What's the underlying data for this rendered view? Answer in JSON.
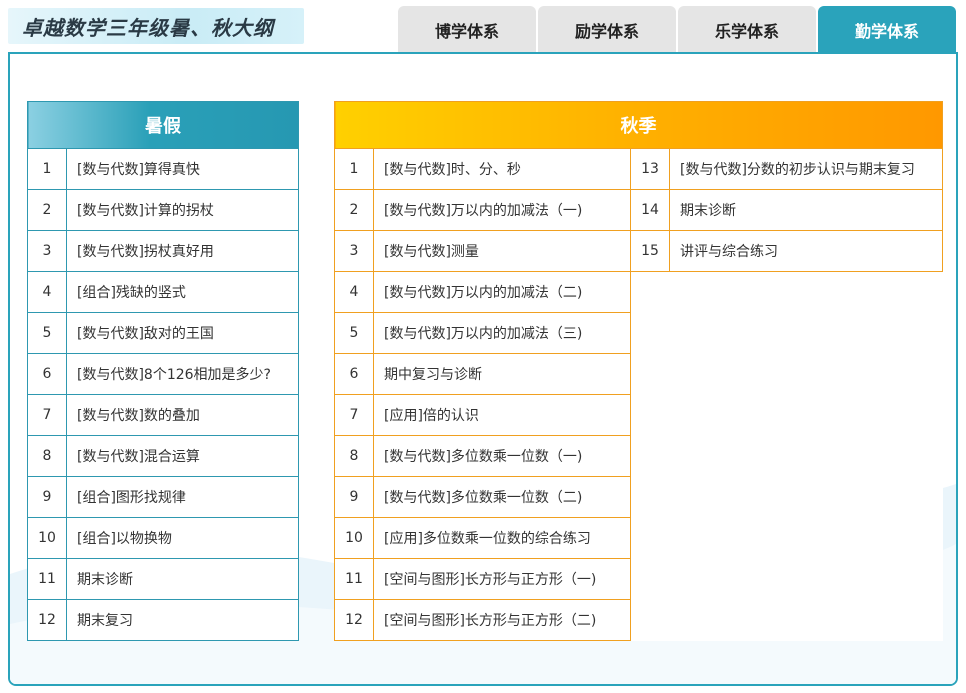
{
  "header": {
    "title": "卓越数学三年级暑、秋大纲",
    "tabs": [
      {
        "label": "博学体系",
        "active": false
      },
      {
        "label": "励学体系",
        "active": false
      },
      {
        "label": "乐学体系",
        "active": false
      },
      {
        "label": "勤学体系",
        "active": true
      }
    ]
  },
  "colors": {
    "accent": "#2aa3bb",
    "summer_border": "#2e98b0",
    "autumn_border": "#f0a020",
    "autumn_header_start": "#ffd000",
    "autumn_header_end": "#ff9800"
  },
  "summer": {
    "title": "暑假",
    "rows": [
      {
        "num": "1",
        "text": "[数与代数]算得真快"
      },
      {
        "num": "2",
        "text": "[数与代数]计算的拐杖"
      },
      {
        "num": "3",
        "text": "[数与代数]拐杖真好用"
      },
      {
        "num": "4",
        "text": "[组合]残缺的竖式"
      },
      {
        "num": "5",
        "text": "[数与代数]敌对的王国"
      },
      {
        "num": "6",
        "text": "[数与代数]8个126相加是多少?"
      },
      {
        "num": "7",
        "text": "[数与代数]数的叠加"
      },
      {
        "num": "8",
        "text": "[数与代数]混合运算"
      },
      {
        "num": "9",
        "text": "[组合]图形找规律"
      },
      {
        "num": "10",
        "text": "[组合]以物换物"
      },
      {
        "num": "11",
        "text": "期末诊断"
      },
      {
        "num": "12",
        "text": "期末复习"
      }
    ]
  },
  "autumn": {
    "title": "秋季",
    "left_rows": [
      {
        "num": "1",
        "text": "[数与代数]时、分、秒"
      },
      {
        "num": "2",
        "text": "[数与代数]万以内的加减法（一)"
      },
      {
        "num": "3",
        "text": "[数与代数]测量"
      },
      {
        "num": "4",
        "text": "[数与代数]万以内的加减法（二)"
      },
      {
        "num": "5",
        "text": "[数与代数]万以内的加减法（三)"
      },
      {
        "num": "6",
        "text": "期中复习与诊断"
      },
      {
        "num": "7",
        "text": "[应用]倍的认识"
      },
      {
        "num": "8",
        "text": "[数与代数]多位数乘一位数（一)"
      },
      {
        "num": "9",
        "text": "[数与代数]多位数乘一位数（二)"
      },
      {
        "num": "10",
        "text": "[应用]多位数乘一位数的综合练习"
      },
      {
        "num": "11",
        "text": "[空间与图形]长方形与正方形（一)"
      },
      {
        "num": "12",
        "text": "[空间与图形]长方形与正方形（二)"
      }
    ],
    "right_rows": [
      {
        "num": "13",
        "text": "[数与代数]分数的初步认识与期末复习"
      },
      {
        "num": "14",
        "text": "期末诊断"
      },
      {
        "num": "15",
        "text": "讲评与综合练习"
      }
    ]
  }
}
